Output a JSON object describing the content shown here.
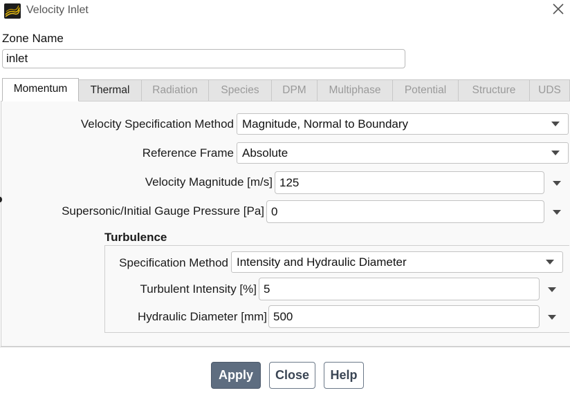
{
  "window": {
    "title": "Velocity Inlet",
    "icon": "fluent-app-icon",
    "close_icon": "close-icon"
  },
  "zone": {
    "label": "Zone Name",
    "value": "inlet"
  },
  "tabs": [
    {
      "label": "Momentum",
      "active": true
    },
    {
      "label": "Thermal",
      "active": false
    },
    {
      "label": "Radiation",
      "active": false
    },
    {
      "label": "Species",
      "active": false
    },
    {
      "label": "DPM",
      "active": false
    },
    {
      "label": "Multiphase",
      "active": false
    },
    {
      "label": "Potential",
      "active": false
    },
    {
      "label": "Structure",
      "active": false
    },
    {
      "label": "UDS",
      "active": false
    }
  ],
  "momentum": {
    "velocity_spec": {
      "label": "Velocity Specification Method",
      "value": "Magnitude, Normal to Boundary"
    },
    "reference_frame": {
      "label": "Reference Frame",
      "value": "Absolute"
    },
    "velocity_magnitude": {
      "label": "Velocity Magnitude [m/s]",
      "value": "125"
    },
    "gauge_pressure": {
      "label": "Supersonic/Initial Gauge Pressure [Pa]",
      "value": "0"
    }
  },
  "turbulence": {
    "title": "Turbulence",
    "spec_method": {
      "label": "Specification Method",
      "value": "Intensity and Hydraulic Diameter"
    },
    "intensity": {
      "label": "Turbulent Intensity [%]",
      "value": "5"
    },
    "hydraulic_diameter": {
      "label": "Hydraulic Diameter [mm]",
      "value": "500"
    }
  },
  "buttons": {
    "apply": "Apply",
    "close": "Close",
    "help": "Help"
  },
  "colors": {
    "primary_button": "#5e6d80",
    "panel_bg": "#f9f9f9",
    "tab_inactive": "#e4e4e4"
  }
}
